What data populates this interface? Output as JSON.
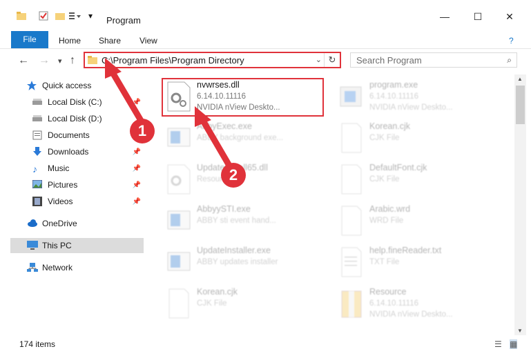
{
  "window": {
    "title": "Program"
  },
  "ribbon": {
    "tabs": [
      "File",
      "Home",
      "Share",
      "View"
    ]
  },
  "address": {
    "path": "C:\\Program Files\\Program Directory"
  },
  "search": {
    "placeholder": "Search Program"
  },
  "sidebar": {
    "items": [
      {
        "label": "Quick access",
        "icon": "star-icon"
      },
      {
        "label": "Local Disk (C:)",
        "icon": "drive-icon"
      },
      {
        "label": "Local Disk (D:)",
        "icon": "drive-icon"
      },
      {
        "label": "Documents",
        "icon": "documents-icon"
      },
      {
        "label": "Downloads",
        "icon": "download-icon"
      },
      {
        "label": "Music",
        "icon": "music-icon"
      },
      {
        "label": "Pictures",
        "icon": "pictures-icon"
      },
      {
        "label": "Videos",
        "icon": "videos-icon"
      },
      {
        "label": "OneDrive",
        "icon": "cloud-icon"
      },
      {
        "label": "This PC",
        "icon": "computer-icon"
      },
      {
        "label": "Network",
        "icon": "network-icon"
      }
    ]
  },
  "files": [
    {
      "name": "nvwrses.dll",
      "line2": "6.14.10.11116",
      "line3": "NVIDIA nView Deskto..."
    },
    {
      "name": "program.exe",
      "line2": "6.14.10.11116",
      "line3": "NVIDIA nView Deskto..."
    },
    {
      "name": "AbbyExec.exe",
      "line2": "ABBY background exe...",
      "line3": ""
    },
    {
      "name": "Korean.cjk",
      "line2": "CJK File",
      "line3": ""
    },
    {
      "name": "UpdateInstall65.dll",
      "line2": "Resource",
      "line3": ""
    },
    {
      "name": "DefaultFont.cjk",
      "line2": "CJK File",
      "line3": ""
    },
    {
      "name": "AbbyySTI.exe",
      "line2": "ABBY sti event hand...",
      "line3": ""
    },
    {
      "name": "Arabic.wrd",
      "line2": "WRD File",
      "line3": ""
    },
    {
      "name": "UpdateInstaller.exe",
      "line2": "ABBY updates installer",
      "line3": ""
    },
    {
      "name": "help.fineReader.txt",
      "line2": "TXT File",
      "line3": ""
    },
    {
      "name": "Korean.cjk",
      "line2": "CJK File",
      "line3": ""
    },
    {
      "name": "Resource",
      "line2": "6.14.10.11116",
      "line3": "NVIDIA nView Deskto..."
    }
  ],
  "status": {
    "count": "174 items"
  },
  "markers": [
    "1",
    "2"
  ],
  "colors": {
    "accent": "#1979ca",
    "highlight": "#e0323a"
  }
}
